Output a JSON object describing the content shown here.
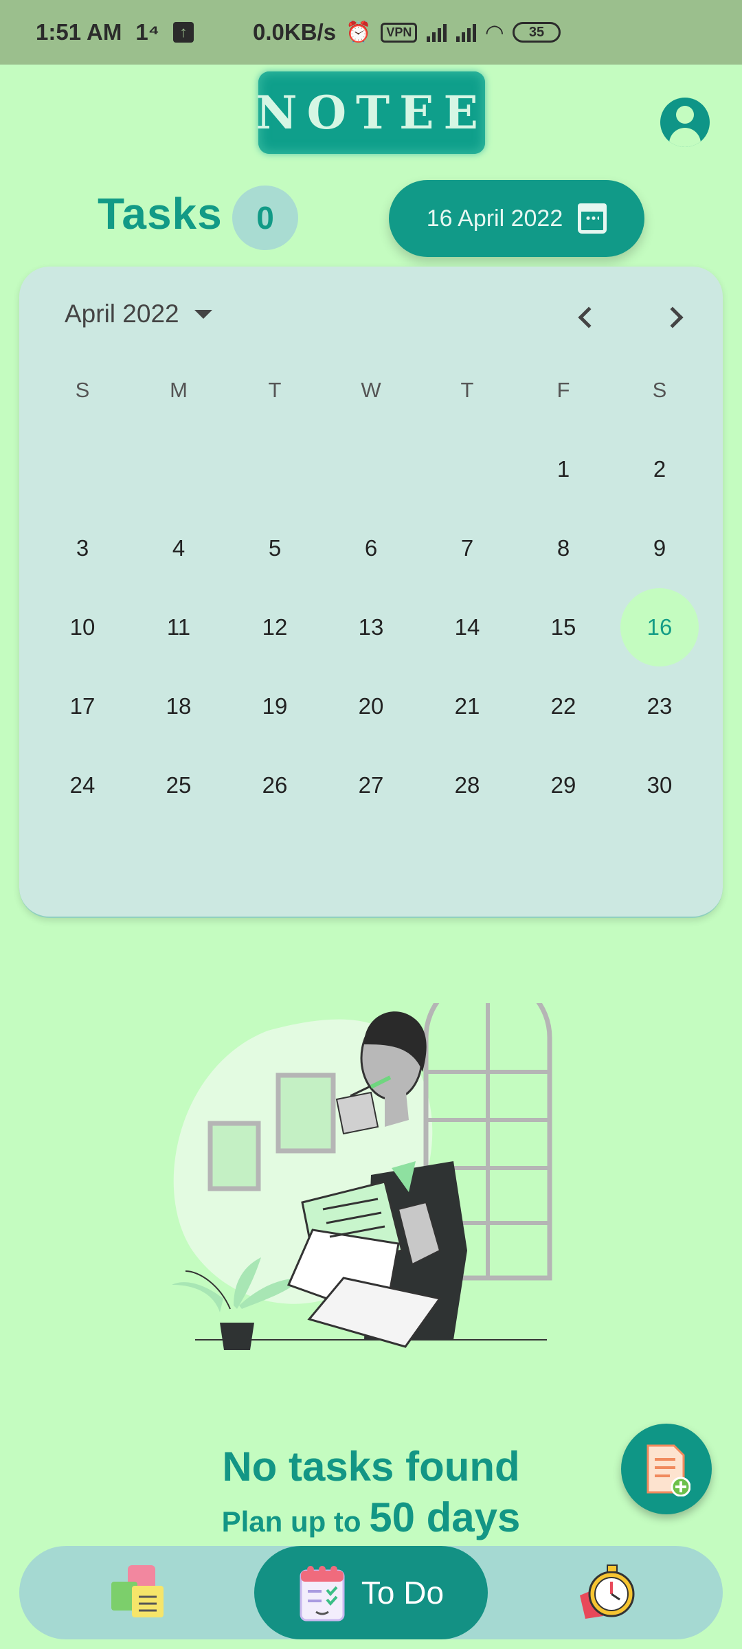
{
  "status_bar": {
    "time": "1:51 AM",
    "indicator": "1⁴",
    "speed": "0.0KB/s",
    "vpn": "VPN",
    "battery": "35"
  },
  "header": {
    "logo_text": "NOTEE",
    "profile_icon": "account-circle-icon"
  },
  "tasks": {
    "title": "Tasks",
    "count": "0",
    "date_button_label": "16 April 2022",
    "date_icon": "calendar-icon"
  },
  "calendar": {
    "month_label": "April 2022",
    "weekdays": [
      "S",
      "M",
      "T",
      "W",
      "T",
      "F",
      "S"
    ],
    "leading_blanks": 5,
    "days": [
      "1",
      "2",
      "3",
      "4",
      "5",
      "6",
      "7",
      "8",
      "9",
      "10",
      "11",
      "12",
      "13",
      "14",
      "15",
      "16",
      "17",
      "18",
      "19",
      "20",
      "21",
      "22",
      "23",
      "24",
      "25",
      "26",
      "27",
      "28",
      "29",
      "30"
    ],
    "selected_day": "16"
  },
  "empty_state": {
    "title": "No tasks found",
    "sub_prefix": "Plan up to",
    "sub_highlight": "50 days"
  },
  "fab": {
    "icon": "add-task-icon"
  },
  "bottom_nav": {
    "notes_icon": "sticky-notes-icon",
    "todo_label": "To Do",
    "todo_icon": "todo-list-icon",
    "timer_icon": "stopwatch-icon"
  },
  "colors": {
    "background": "#c4fcc0",
    "accent": "#119a88",
    "calendar_bg": "#cce8e1",
    "nav_bg": "#a5d9d2"
  }
}
